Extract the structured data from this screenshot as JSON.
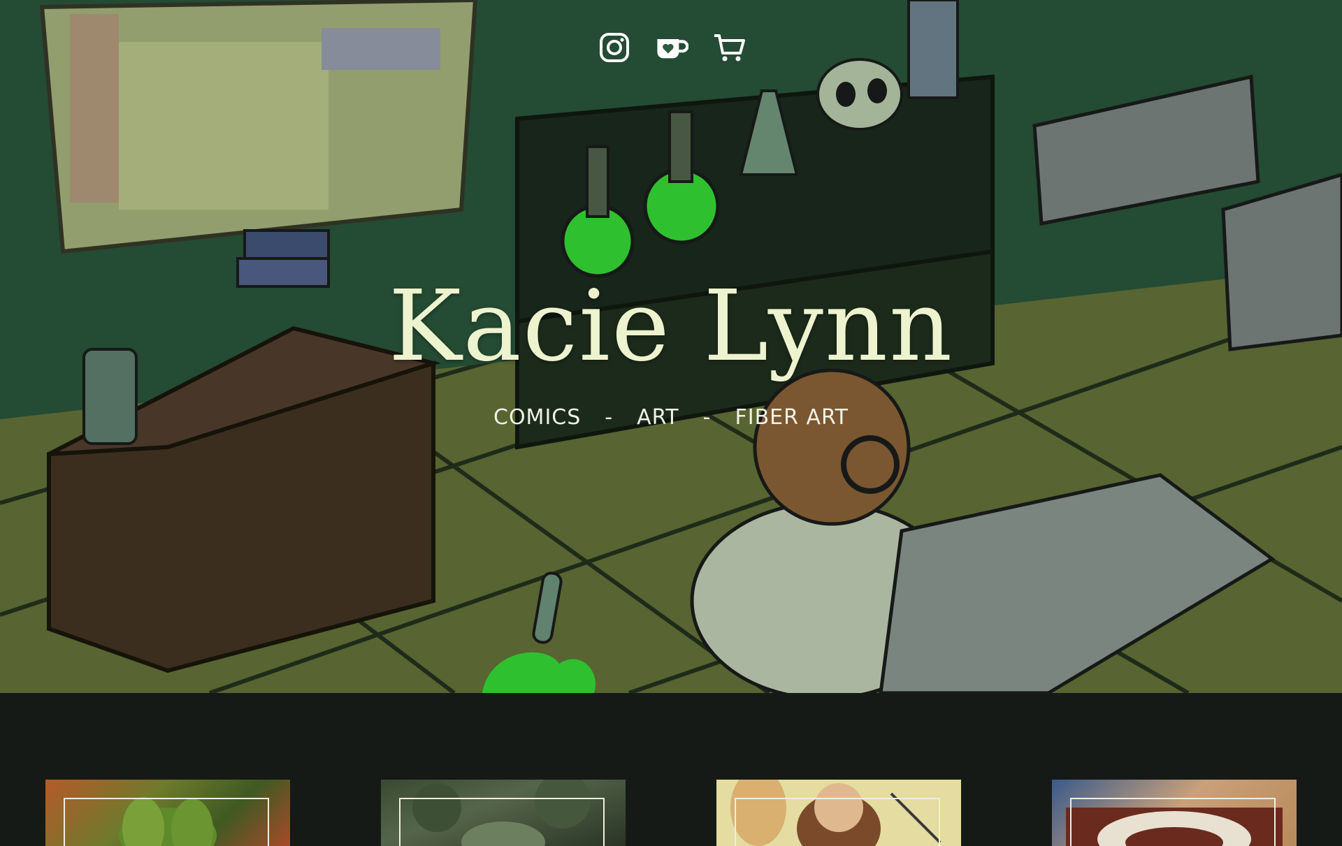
{
  "site": {
    "title": "Kacie Lynn"
  },
  "social": [
    {
      "name": "instagram",
      "icon": "instagram-icon"
    },
    {
      "name": "ko-fi",
      "icon": "kofi-cup-heart-icon"
    },
    {
      "name": "shop",
      "icon": "shopping-cart-icon"
    }
  ],
  "nav": {
    "items": [
      "COMICS",
      "ART",
      "FIBER ART"
    ],
    "separator": "-"
  },
  "colors": {
    "title": "#eef3cf",
    "nav_text": "#f2f2e8",
    "page_background": "#151a17",
    "hero_green": "#2d5a3d",
    "potion_green": "#3cf03c"
  },
  "cards": [
    {
      "name": "comics-card",
      "theme": "green plant illustration"
    },
    {
      "name": "art-card",
      "theme": "dark forest illustration"
    },
    {
      "name": "characters-card",
      "theme": "character comic panel"
    },
    {
      "name": "fiber-art-card",
      "theme": "rug fiber art"
    }
  ]
}
